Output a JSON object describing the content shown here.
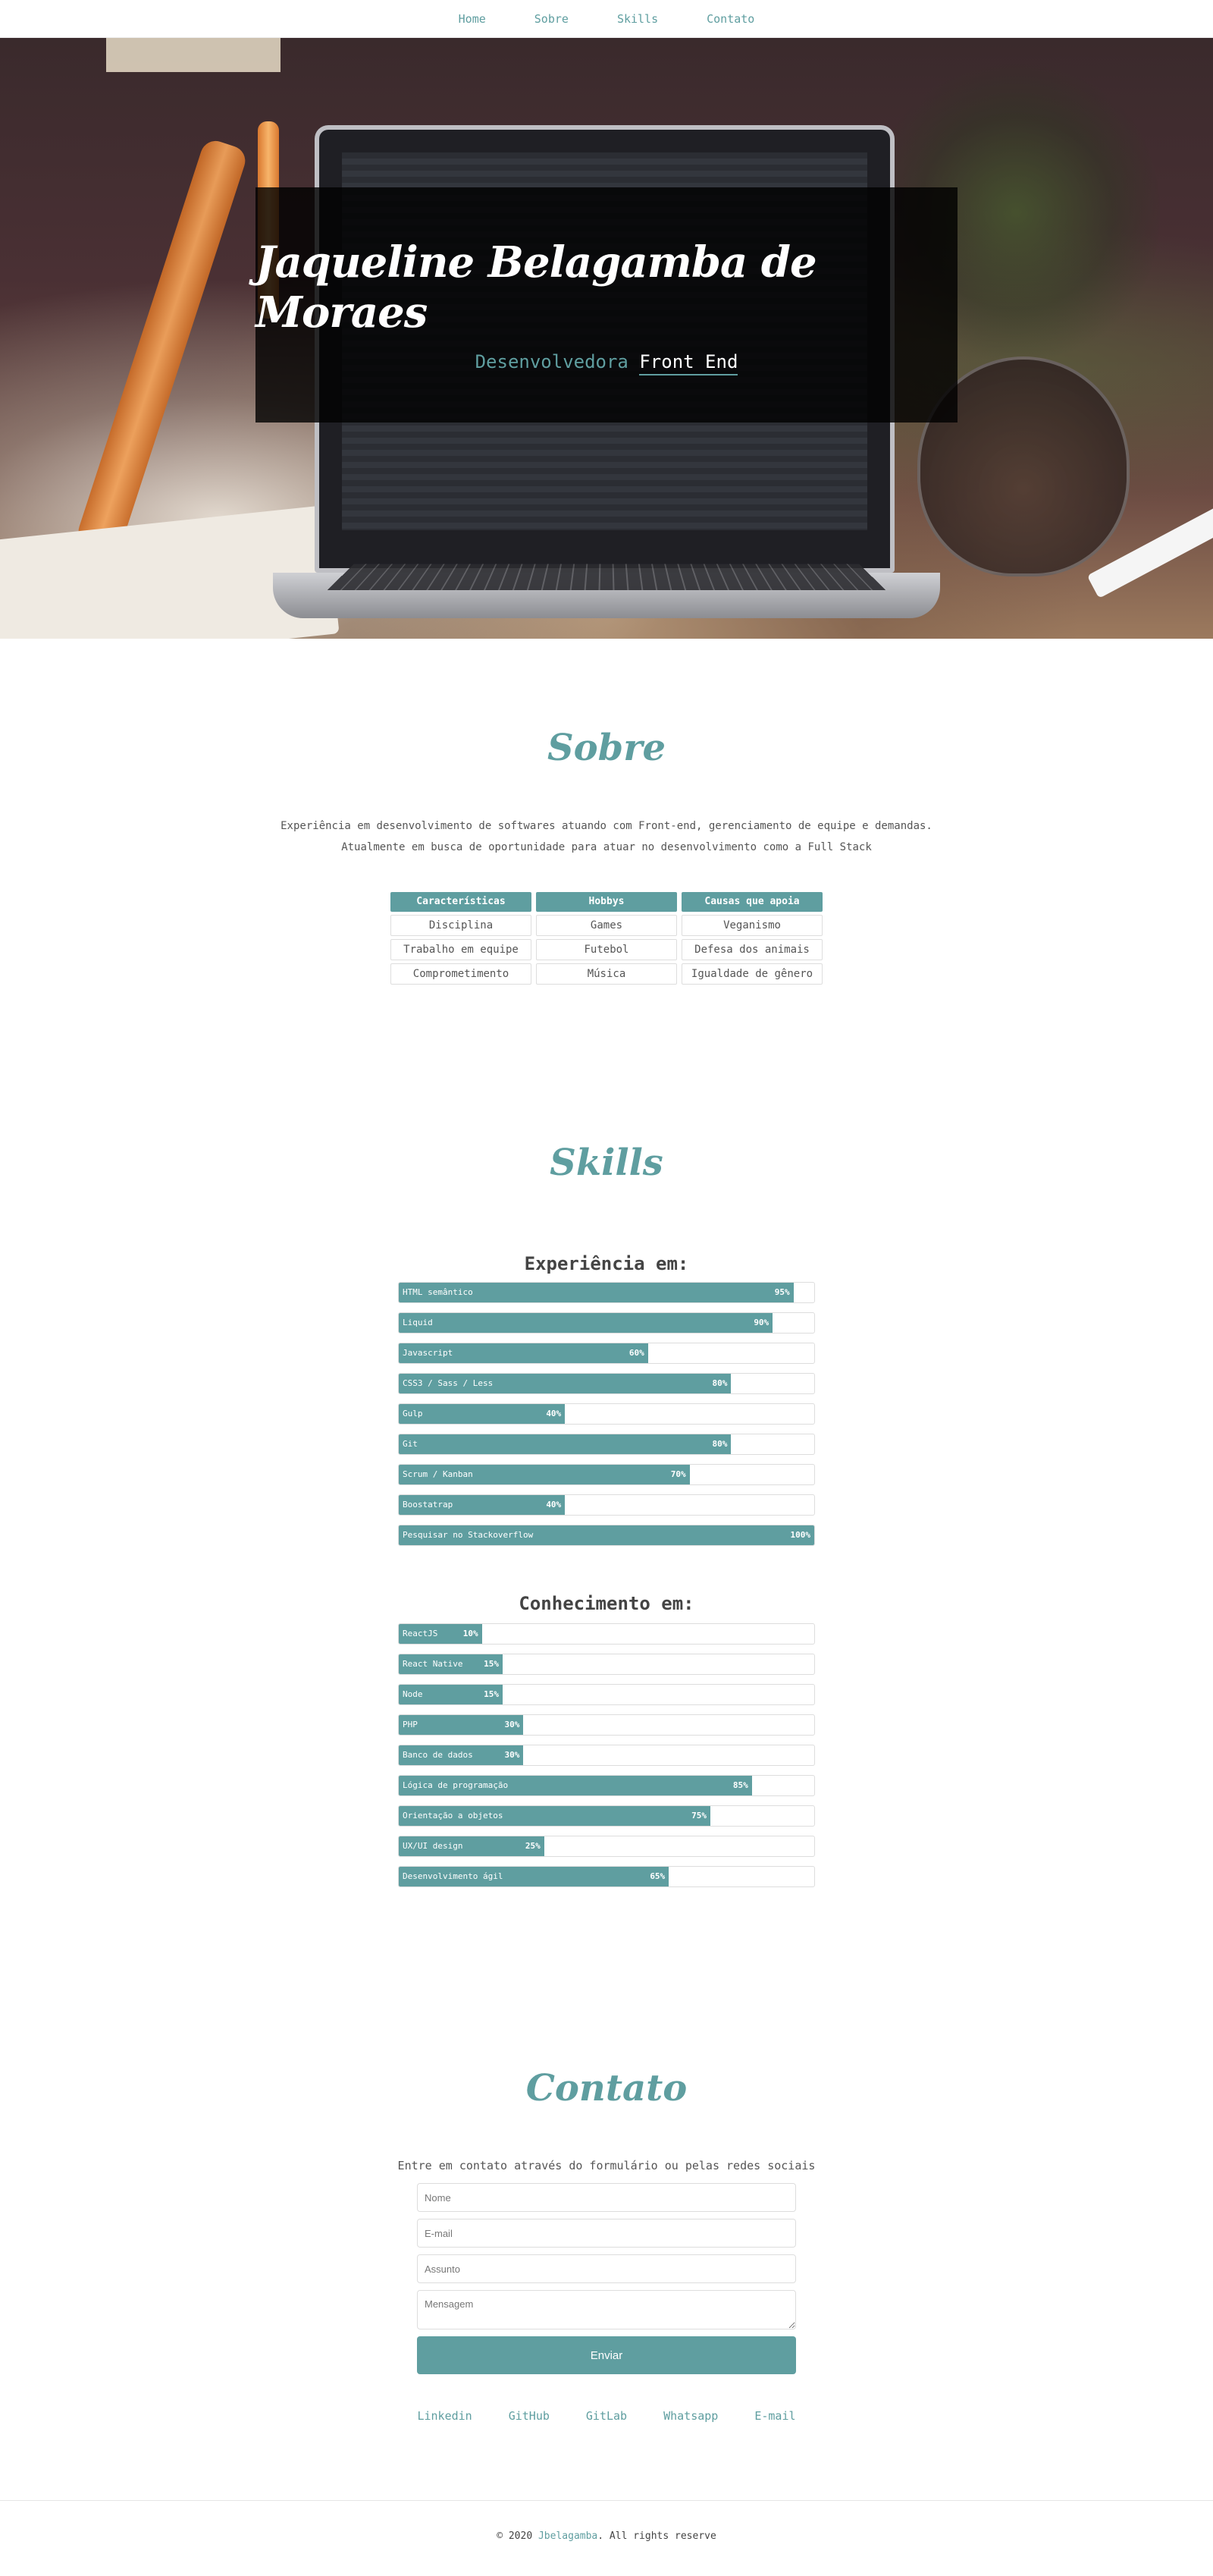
{
  "nav": {
    "items": [
      {
        "label": "Home"
      },
      {
        "label": "Sobre"
      },
      {
        "label": "Skills"
      },
      {
        "label": "Contato"
      }
    ]
  },
  "hero": {
    "name": "Jaqueline Belagamba de Moraes",
    "role_prefix": "Desenvolvedora",
    "role_accent": "Front End"
  },
  "sobre": {
    "title": "Sobre",
    "paragraph_1": "Experiência em desenvolvimento de softwares atuando com Front-end, gerenciamento de equipe e demandas.",
    "paragraph_2": "Atualmente em busca de oportunidade para atuar no desenvolvimento como a Full Stack",
    "table": {
      "headers": [
        "Características",
        "Hobbys",
        "Causas que apoia"
      ],
      "rows": [
        [
          "Disciplina",
          "Games",
          "Veganismo"
        ],
        [
          "Trabalho em equipe",
          "Futebol",
          "Defesa dos animais"
        ],
        [
          "Comprometimento",
          "Música",
          "Igualdade de gênero"
        ]
      ]
    }
  },
  "skills": {
    "title": "Skills",
    "experience": {
      "title": "Experiência em:",
      "items": [
        {
          "label": "HTML semântico",
          "pct": "95%",
          "value": 95
        },
        {
          "label": "Liquid",
          "pct": "90%",
          "value": 90
        },
        {
          "label": "Javascript",
          "pct": "60%",
          "value": 60
        },
        {
          "label": "CSS3 / Sass / Less",
          "pct": "80%",
          "value": 80
        },
        {
          "label": "Gulp",
          "pct": "40%",
          "value": 40
        },
        {
          "label": "Git",
          "pct": "80%",
          "value": 80
        },
        {
          "label": "Scrum / Kanban",
          "pct": "70%",
          "value": 70
        },
        {
          "label": "Boostatrap",
          "pct": "40%",
          "value": 40
        },
        {
          "label": "Pesquisar no Stackoverflow",
          "pct": "100%",
          "value": 100
        }
      ]
    },
    "knowledge": {
      "title": "Conhecimento em:",
      "items": [
        {
          "label": "ReactJS",
          "pct": "10%",
          "value": 20
        },
        {
          "label": "React Native",
          "pct": "15%",
          "value": 25
        },
        {
          "label": "Node",
          "pct": "15%",
          "value": 25
        },
        {
          "label": "PHP",
          "pct": "30%",
          "value": 30
        },
        {
          "label": "Banco de dados",
          "pct": "30%",
          "value": 30
        },
        {
          "label": "Lógica de programação",
          "pct": "85%",
          "value": 85
        },
        {
          "label": "Orientação a objetos",
          "pct": "75%",
          "value": 75
        },
        {
          "label": "UX/UI design",
          "pct": "25%",
          "value": 35
        },
        {
          "label": "Desenvolvimento ágil",
          "pct": "65%",
          "value": 65
        }
      ]
    }
  },
  "contato": {
    "title": "Contato",
    "intro": "Entre em contato através do formulário ou pelas redes sociais",
    "fields": {
      "name_placeholder": "Nome",
      "email_placeholder": "E-mail",
      "subject_placeholder": "Assunto",
      "message_placeholder": "Mensagem"
    },
    "send_label": "Enviar",
    "social": [
      {
        "label": "Linkedin"
      },
      {
        "label": "GitHub"
      },
      {
        "label": "GitLab"
      },
      {
        "label": "Whatsapp"
      },
      {
        "label": "E-mail"
      }
    ]
  },
  "footer": {
    "prefix": "© 2020",
    "brand": "Jbelagamba",
    "suffix": ". All rights reserve"
  },
  "colors": {
    "accent": "#5f9ea0"
  }
}
